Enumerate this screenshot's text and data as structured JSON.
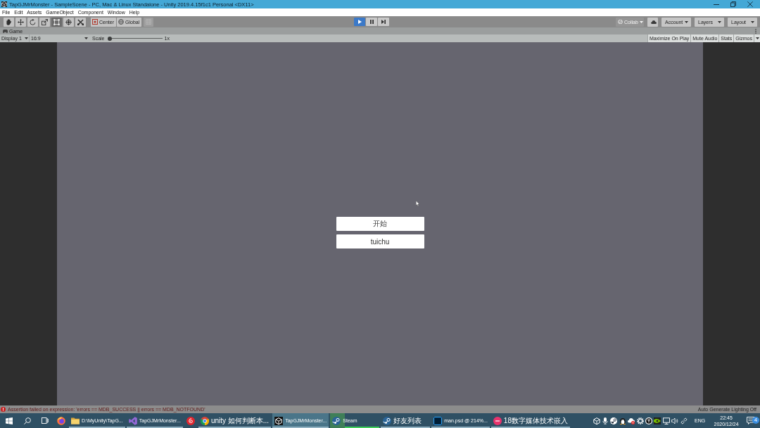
{
  "window": {
    "title": "TapGJMrMonster - SampleScene - PC, Mac & Linux Standalone - Unity 2019.4.15f1c1 Personal <DX11>"
  },
  "menu_bar": [
    "File",
    "Edit",
    "Assets",
    "GameObject",
    "Component",
    "Window",
    "Help"
  ],
  "toolbar": {
    "tools": [
      {
        "selected": false
      },
      {
        "selected": false
      },
      {
        "selected": false
      },
      {
        "selected": false
      },
      {
        "selected": true
      },
      {
        "selected": false
      },
      {
        "selected": false
      }
    ],
    "pivot_mode": "Center",
    "pivot_rotation": "Global",
    "snap": {
      "disabled": true
    },
    "play_mode": {
      "playing": true,
      "paused": false
    },
    "collab": {
      "label": "Collab",
      "disabled": true
    },
    "account": "Account",
    "layers": "Layers",
    "layout": "Layout"
  },
  "game_tab": {
    "title": "Game"
  },
  "game_toolbar": {
    "display": "Display 1",
    "aspect": "16:9",
    "scale_label": "Scale",
    "scale": {
      "level": 0
    },
    "scale_value": "1x",
    "toggles": [
      {
        "label": "Maximize On Play",
        "on": false
      },
      {
        "label": "Mute Audio",
        "on": false
      },
      {
        "label": "Stats",
        "on": false
      },
      {
        "label": "Gizmos",
        "on": false
      }
    ]
  },
  "game_view": {
    "buttons": [
      "开始",
      "tuichu"
    ]
  },
  "status_bar": {
    "message": {
      "kind": "error",
      "text": "Assertion failed on expression: 'errors == MDB_SUCCESS || errors == MDB_NOTFOUND'"
    },
    "lighting": "Auto Generate Lighting Off"
  },
  "taskbar": {
    "items": [
      {
        "running": false,
        "selected": false
      },
      {
        "label": "D:\\MyUnity\\TapG...",
        "running": true,
        "selected": false
      },
      {
        "label": "TapGJMrMonster...",
        "running": true,
        "selected": false
      },
      {
        "running": false,
        "selected": false
      },
      {
        "label": "unity 如何判断本...",
        "running": true,
        "selected": false
      },
      {
        "label": "TapGJMrMonster...",
        "running": true,
        "selected": true
      },
      {
        "label": "Steam",
        "running": true,
        "selected": false,
        "level": 0.3
      },
      {
        "label": "好友列表",
        "running": true,
        "selected": false
      },
      {
        "label": "man.psd @ 214%...",
        "running": true,
        "selected": false
      },
      {
        "label": "18数字媒体技术嵌入",
        "running": true,
        "selected": false
      }
    ],
    "tray": {
      "language": "ENG",
      "time": "22:45",
      "date": "2020/12/24",
      "notifications": "4"
    }
  }
}
